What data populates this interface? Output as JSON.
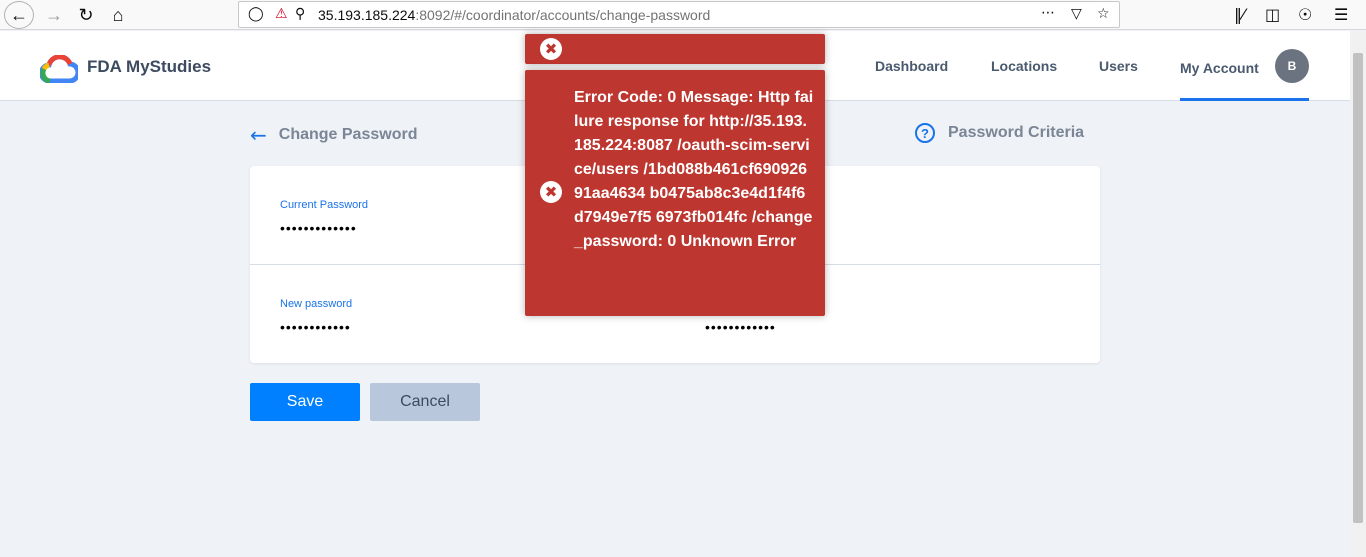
{
  "browser": {
    "url_host": "35.193.185.224",
    "url_rest": ":8092/#/coordinator/accounts/change-password",
    "icons": {
      "back": "back-arrow-icon",
      "forward": "forward-arrow-icon",
      "reload": "reload-icon",
      "home": "home-icon",
      "shield": "shield-icon",
      "insecure": "insecure-lock-icon",
      "key": "key-icon",
      "more": "more-icon",
      "pocket": "pocket-icon",
      "bookmark": "star-icon",
      "library": "library-icon",
      "sidebar": "sidebar-icon",
      "account": "account-icon",
      "menu": "menu-icon"
    }
  },
  "header": {
    "brand": "FDA MyStudies",
    "nav": [
      "Dashboard",
      "Locations",
      "Users",
      "My Account"
    ],
    "avatar_initial": "B",
    "accent_color": "#1a73e8"
  },
  "page": {
    "title": "Change Password",
    "criteria_link": "Password Criteria",
    "current_password_label": "Current Password",
    "current_password_value": "•••••••••••••",
    "new_password_label": "New password",
    "new_password_value": "••••••••••••",
    "confirm_password_value": "••••••••••••",
    "save_label": "Save",
    "cancel_label": "Cancel"
  },
  "toast": {
    "message": "Error Code: 0 Message: Http failure response for http://35.193.185.224:8087 /oauth-scim-service/users /1bd088b461cf69092691aa4634 b0475ab8c3e4d1f4f6d7949e7f5 6973fb014fc /change_password: 0 Unknown Error",
    "color": "#bd362f"
  }
}
